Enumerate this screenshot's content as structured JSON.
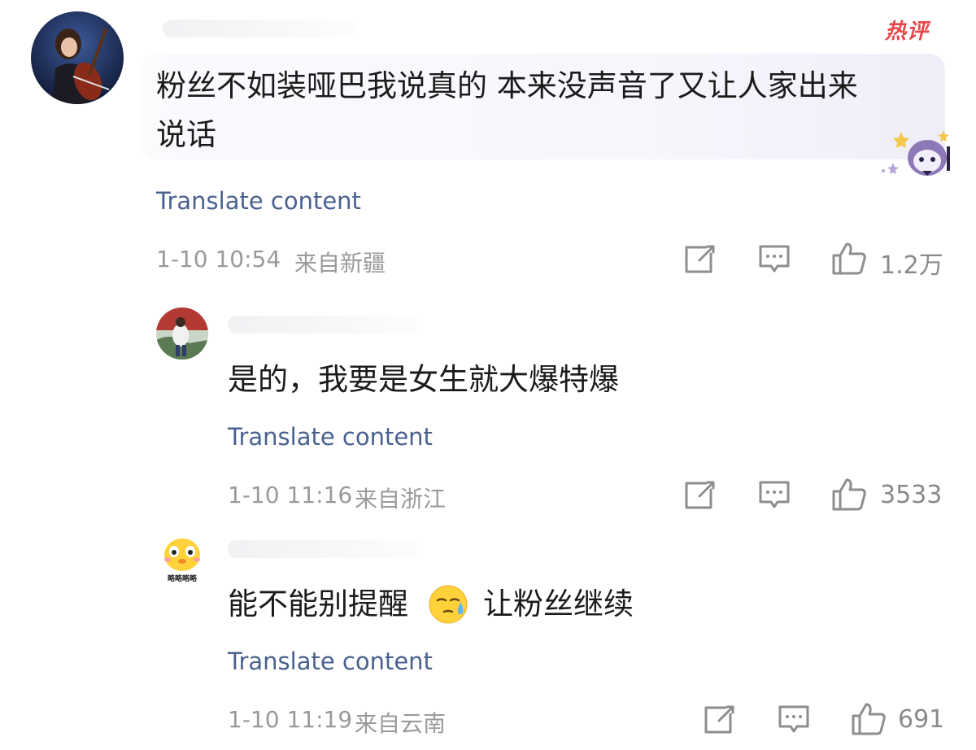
{
  "hot_badge": "热评",
  "translate_label": "Translate content",
  "comments": [
    {
      "text_line1": "粉丝不如装哑巴我说真的 本来没声音了又让人家出来",
      "text_line2": "说话",
      "time": "1-10 10:54",
      "location": "来自新疆",
      "likes": "1.2万"
    },
    {
      "text": "是的，我要是女生就大爆特爆",
      "time": "1-10 11:16",
      "location": "来自浙江",
      "likes": "3533"
    },
    {
      "text_before_emoji": "能不能别提醒",
      "text_after_emoji": "让粉丝继续",
      "time": "1-10 11:19",
      "location": "来自云南",
      "likes": "691",
      "avatar_caption": "略略略略"
    }
  ],
  "icons": {
    "share": "share-icon",
    "comment": "comment-icon",
    "like": "like-icon",
    "emoji": "sweat-emoji-icon"
  },
  "colors": {
    "translate_link": "#4a6190",
    "meta_text": "#9a9a9a",
    "hot_badge": "#e8464a"
  }
}
